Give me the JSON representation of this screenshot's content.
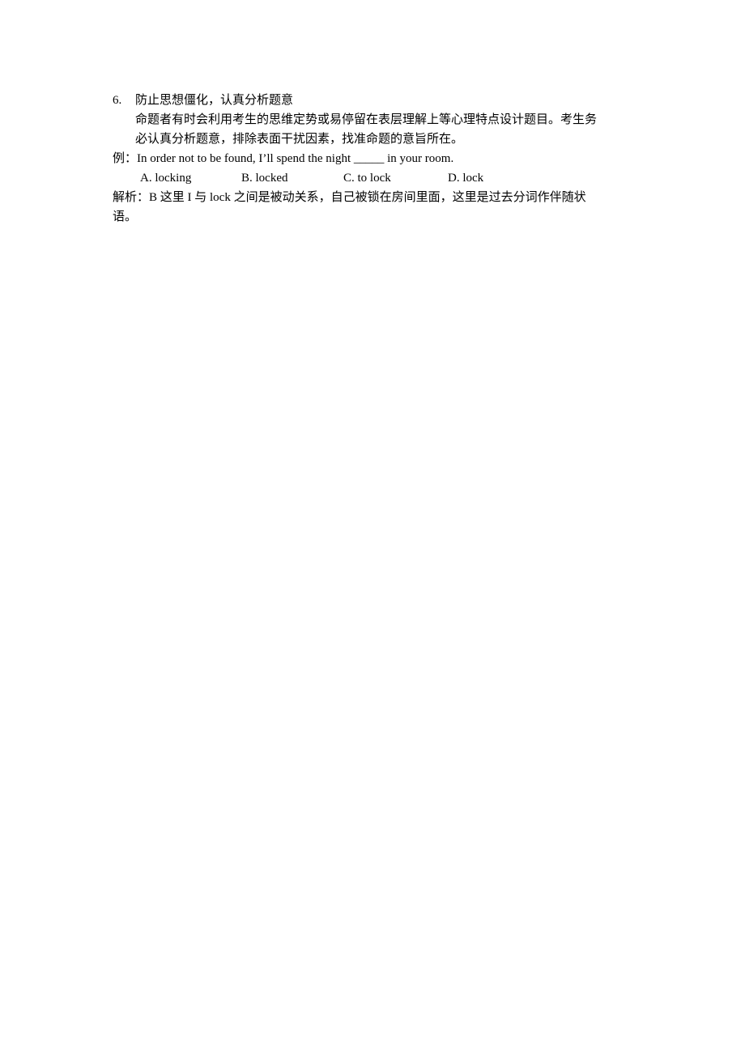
{
  "section": {
    "number": "6.",
    "title": "防止思想僵化，认真分析题意",
    "paragraph_lines": [
      "命题者有时会利用考生的思维定势或易停留在表层理解上等心理特点设计题目。考生务",
      "必认真分析题意，排除表面干扰因素，找准命题的意旨所在。"
    ]
  },
  "example": {
    "label": "例：",
    "question": "In order not to be found, I’ll spend the night _____ in your room.",
    "options": [
      "A. locking",
      "B. locked",
      "C. to lock",
      "D. lock"
    ]
  },
  "analysis": {
    "lines": [
      "解析：B  这里 I  与 lock  之间是被动关系，自己被锁在房间里面，这里是过去分词作伴随状",
      "语。"
    ]
  }
}
